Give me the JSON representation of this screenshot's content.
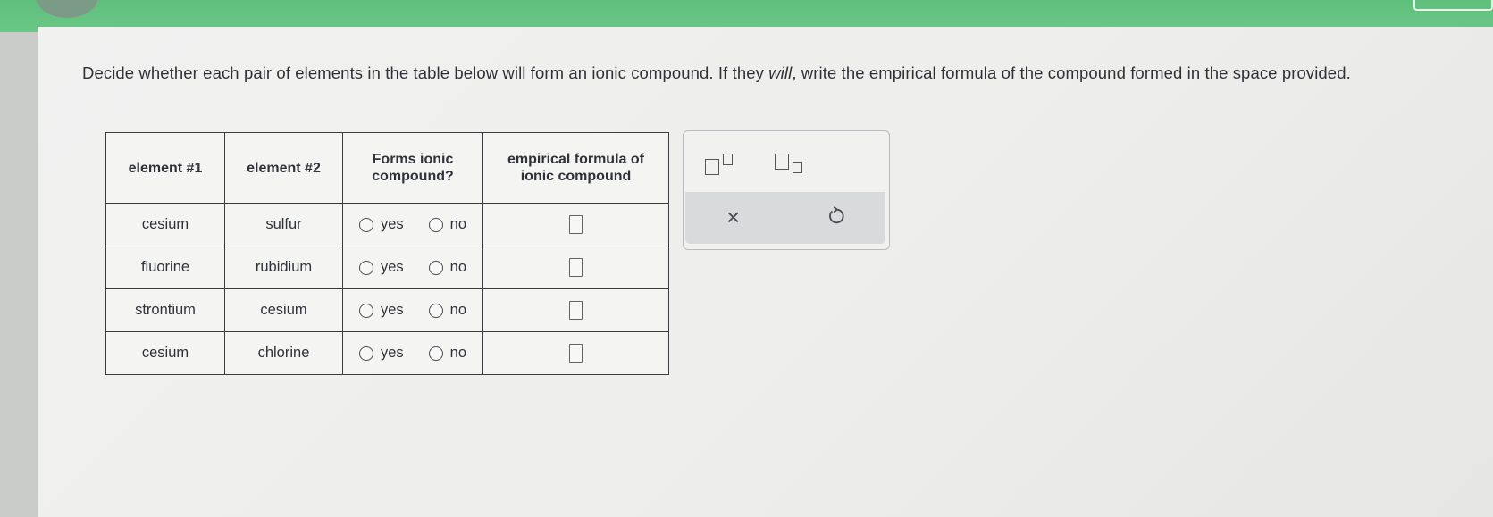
{
  "question": {
    "part1": "Decide whether each pair of elements in the table below will form an ionic compound. If they ",
    "emph": "will",
    "part2": ", write the empirical formula of the compound formed in the space provided."
  },
  "table": {
    "headers": [
      "element #1",
      "element #2",
      "Forms ionic compound?",
      "empirical formula of ionic compound"
    ],
    "yes_label": "yes",
    "no_label": "no",
    "rows": [
      {
        "e1": "cesium",
        "e2": "sulfur"
      },
      {
        "e1": "fluorine",
        "e2": "rubidium"
      },
      {
        "e1": "strontium",
        "e2": "cesium"
      },
      {
        "e1": "cesium",
        "e2": "chlorine"
      }
    ]
  },
  "toolpanel": {
    "superscript_icon": "superscript-icon",
    "subscript_icon": "subscript-icon",
    "clear_icon": "close-icon",
    "clear_symbol": "×",
    "undo_icon": "undo-icon"
  },
  "colors": {
    "header_bar": "#66c482",
    "answer_box_border": "#3d6aa8"
  }
}
